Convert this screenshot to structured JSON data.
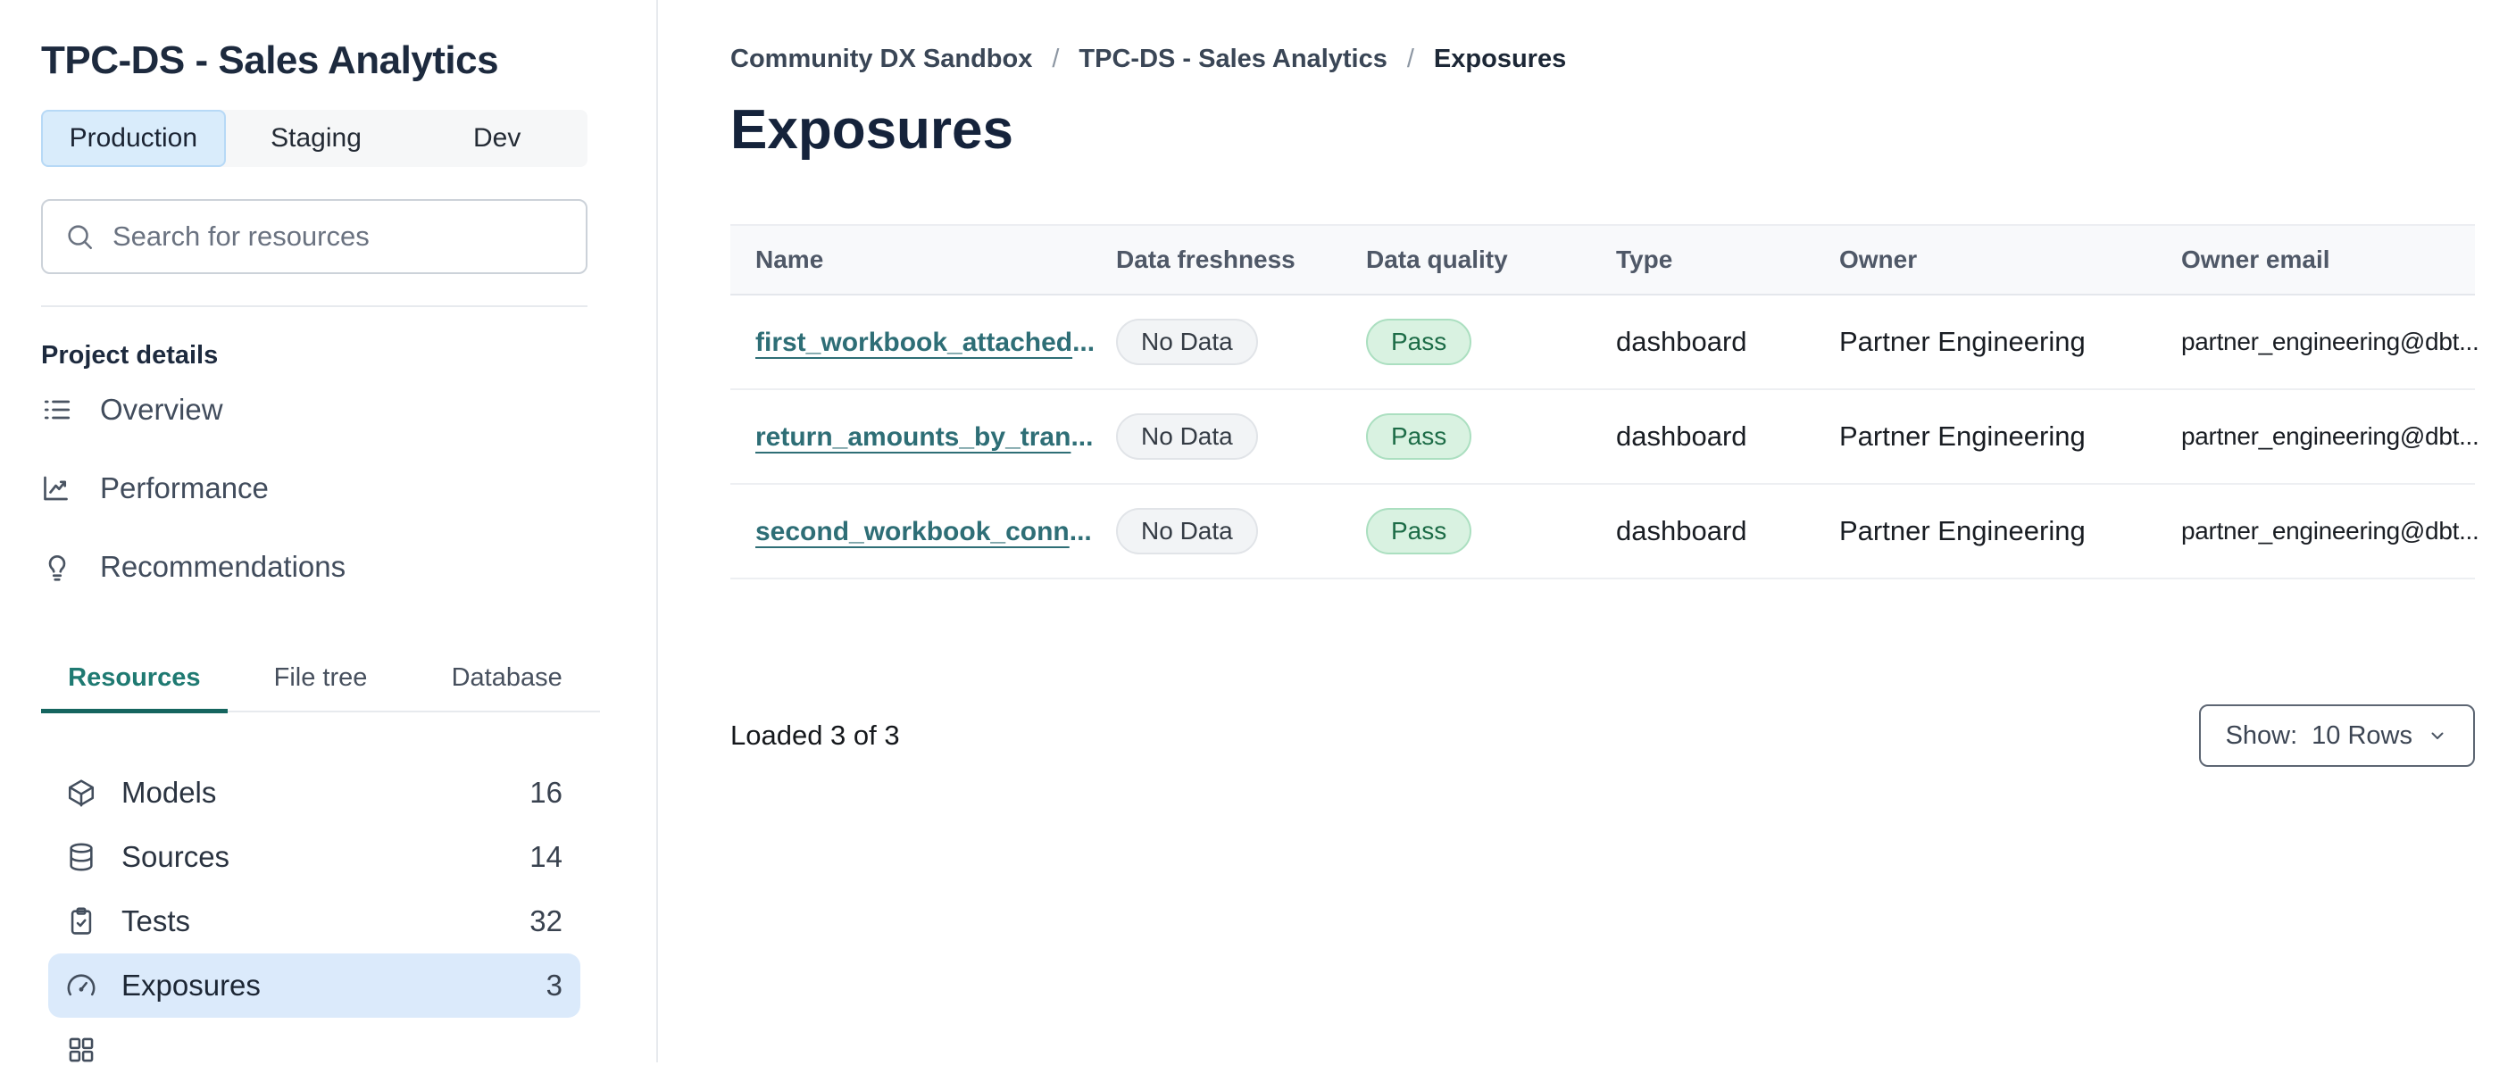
{
  "colors": {
    "accent_teal": "#1f7a72",
    "link_teal": "#2e6e76",
    "highlight_blue": "#dbeafb",
    "env_active_blue": "#d9ecfb",
    "badge_green_bg": "#d9f2e1",
    "badge_green_text": "#1d6c47",
    "badge_gray_bg": "#f2f4f6",
    "navy_text": "#1d2a3e"
  },
  "sidebar": {
    "project_title": "TPC-DS - Sales Analytics",
    "env_tabs": [
      {
        "label": "Production",
        "active": true
      },
      {
        "label": "Staging",
        "active": false
      },
      {
        "label": "Dev",
        "active": false
      }
    ],
    "search": {
      "placeholder": "Search for resources"
    },
    "section_label": "Project details",
    "nav_items": [
      {
        "label": "Overview",
        "icon": "list-icon"
      },
      {
        "label": "Performance",
        "icon": "chart-line-icon"
      },
      {
        "label": "Recommendations",
        "icon": "lightbulb-icon"
      }
    ],
    "panel_tabs": [
      {
        "label": "Resources",
        "active": true
      },
      {
        "label": "File tree",
        "active": false
      },
      {
        "label": "Database",
        "active": false
      }
    ],
    "resources": [
      {
        "label": "Models",
        "count": "16",
        "icon": "cube-icon",
        "active": false
      },
      {
        "label": "Sources",
        "count": "14",
        "icon": "database-icon",
        "active": false
      },
      {
        "label": "Tests",
        "count": "32",
        "icon": "clipboard-check-icon",
        "active": false
      },
      {
        "label": "Exposures",
        "count": "3",
        "icon": "gauge-icon",
        "active": true
      }
    ]
  },
  "main": {
    "breadcrumb": {
      "separator": "/",
      "items": [
        "Community DX Sandbox",
        "TPC-DS - Sales Analytics",
        "Exposures"
      ]
    },
    "page_title": "Exposures",
    "table": {
      "columns": [
        "Name",
        "Data freshness",
        "Data quality",
        "Type",
        "Owner",
        "Owner email"
      ],
      "rows": [
        {
          "name": "first_workbook_attached",
          "name_suffix": "...",
          "freshness": "No Data",
          "quality": "Pass",
          "type": "dashboard",
          "owner": "Partner Engineering",
          "owner_email": "partner_engineering@dbt..."
        },
        {
          "name": "return_amounts_by_tran",
          "name_suffix": "...",
          "freshness": "No Data",
          "quality": "Pass",
          "type": "dashboard",
          "owner": "Partner Engineering",
          "owner_email": "partner_engineering@dbt..."
        },
        {
          "name": "second_workbook_conn",
          "name_suffix": "...",
          "freshness": "No Data",
          "quality": "Pass",
          "type": "dashboard",
          "owner": "Partner Engineering",
          "owner_email": "partner_engineering@dbt..."
        }
      ]
    },
    "footer": {
      "loaded_text": "Loaded 3 of 3",
      "show_label": "Show:",
      "show_value": "10 Rows"
    }
  }
}
